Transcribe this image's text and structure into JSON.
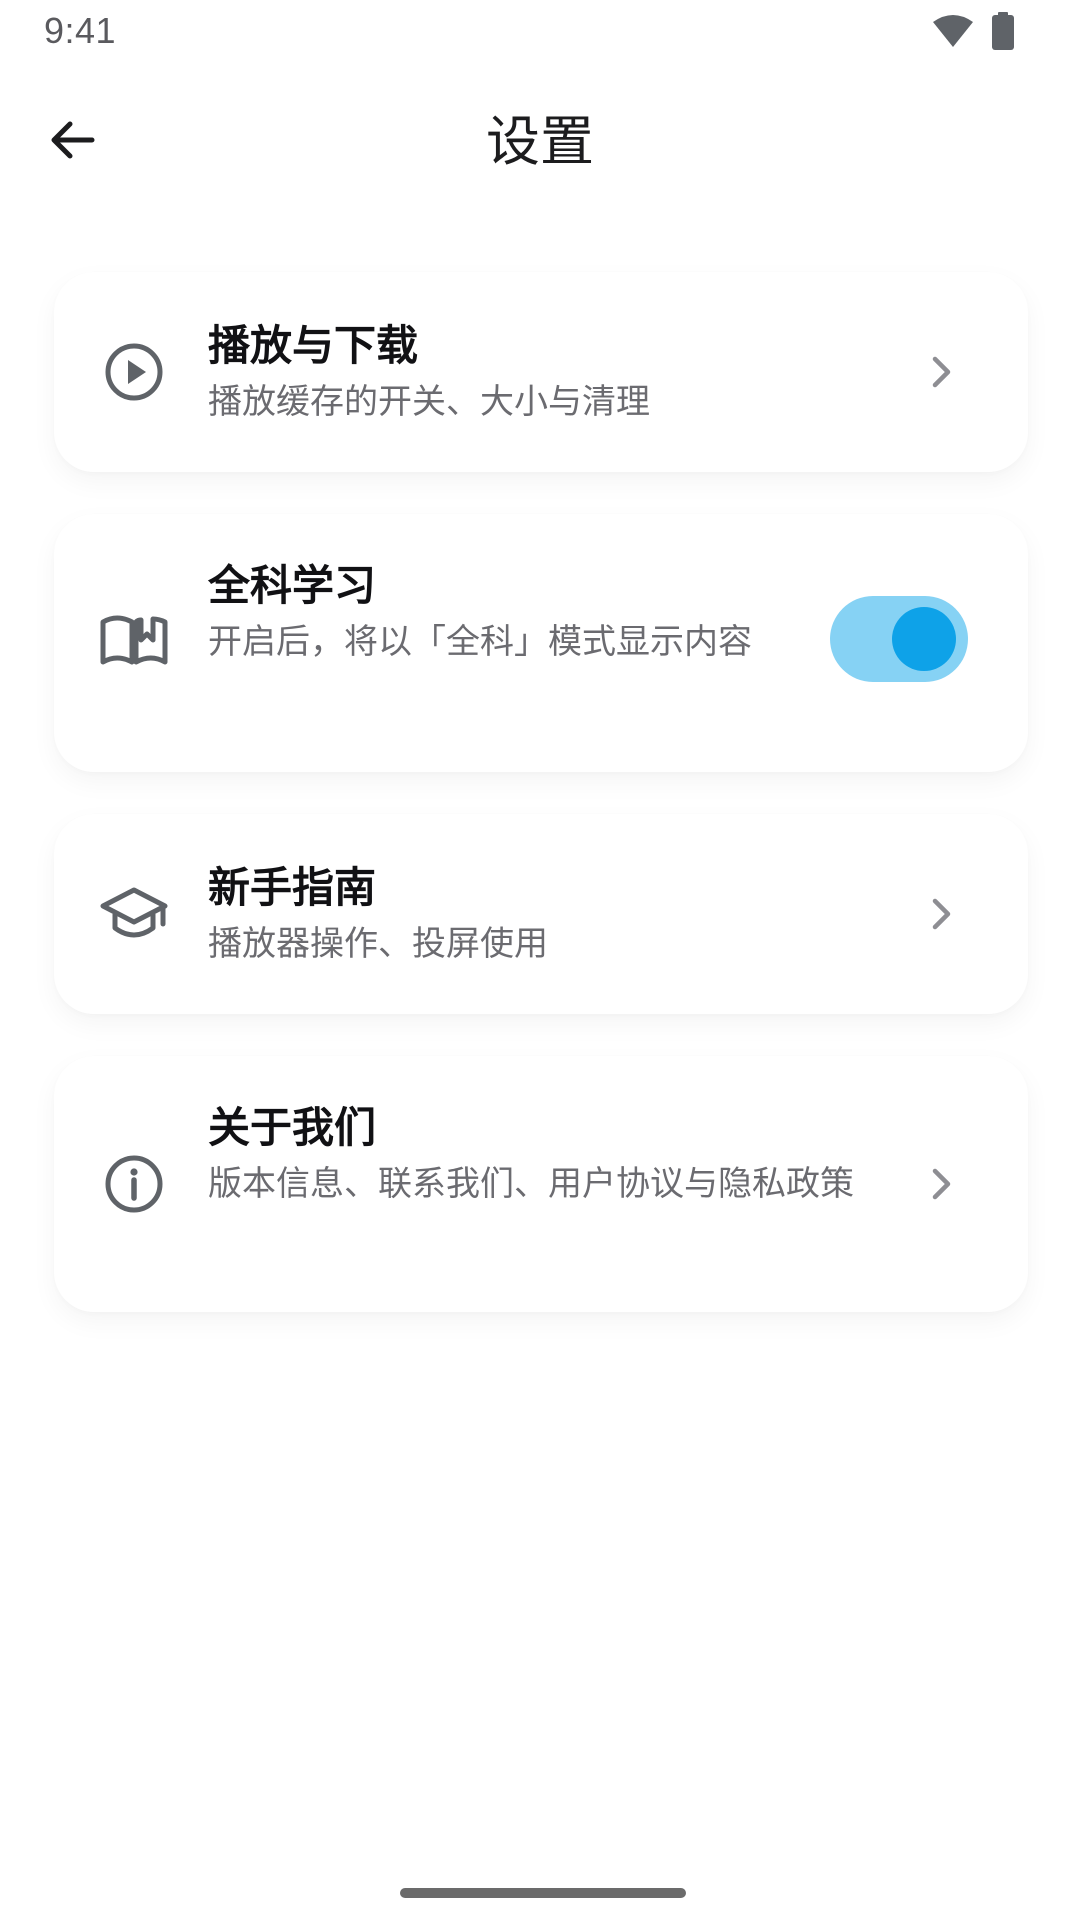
{
  "status_bar": {
    "time": "9:41",
    "icons": [
      "wifi-icon",
      "battery-icon"
    ]
  },
  "header": {
    "title": "设置",
    "back_icon": "arrow-left-icon"
  },
  "settings": {
    "items": [
      {
        "title": "播放与下载",
        "subtitle": "播放缓存的开关、大小与清理",
        "icon": "play-circle-icon",
        "control": "chevron"
      },
      {
        "title": "全科学习",
        "subtitle": "开启后，将以「全科」模式显示内容",
        "icon": "open-book-icon",
        "control": "toggle",
        "toggle_on": true
      },
      {
        "title": "新手指南",
        "subtitle": "播放器操作、投屏使用",
        "icon": "graduation-cap-icon",
        "control": "chevron"
      },
      {
        "title": "关于我们",
        "subtitle": "版本信息、联系我们、用户协议与隐私政策",
        "icon": "info-circle-icon",
        "control": "chevron"
      }
    ]
  },
  "colors": {
    "toggle_track": "#86d2f4",
    "toggle_knob": "#0ea2e8",
    "icon_gray": "#5f6368",
    "chevron_gray": "#8e8e93"
  }
}
